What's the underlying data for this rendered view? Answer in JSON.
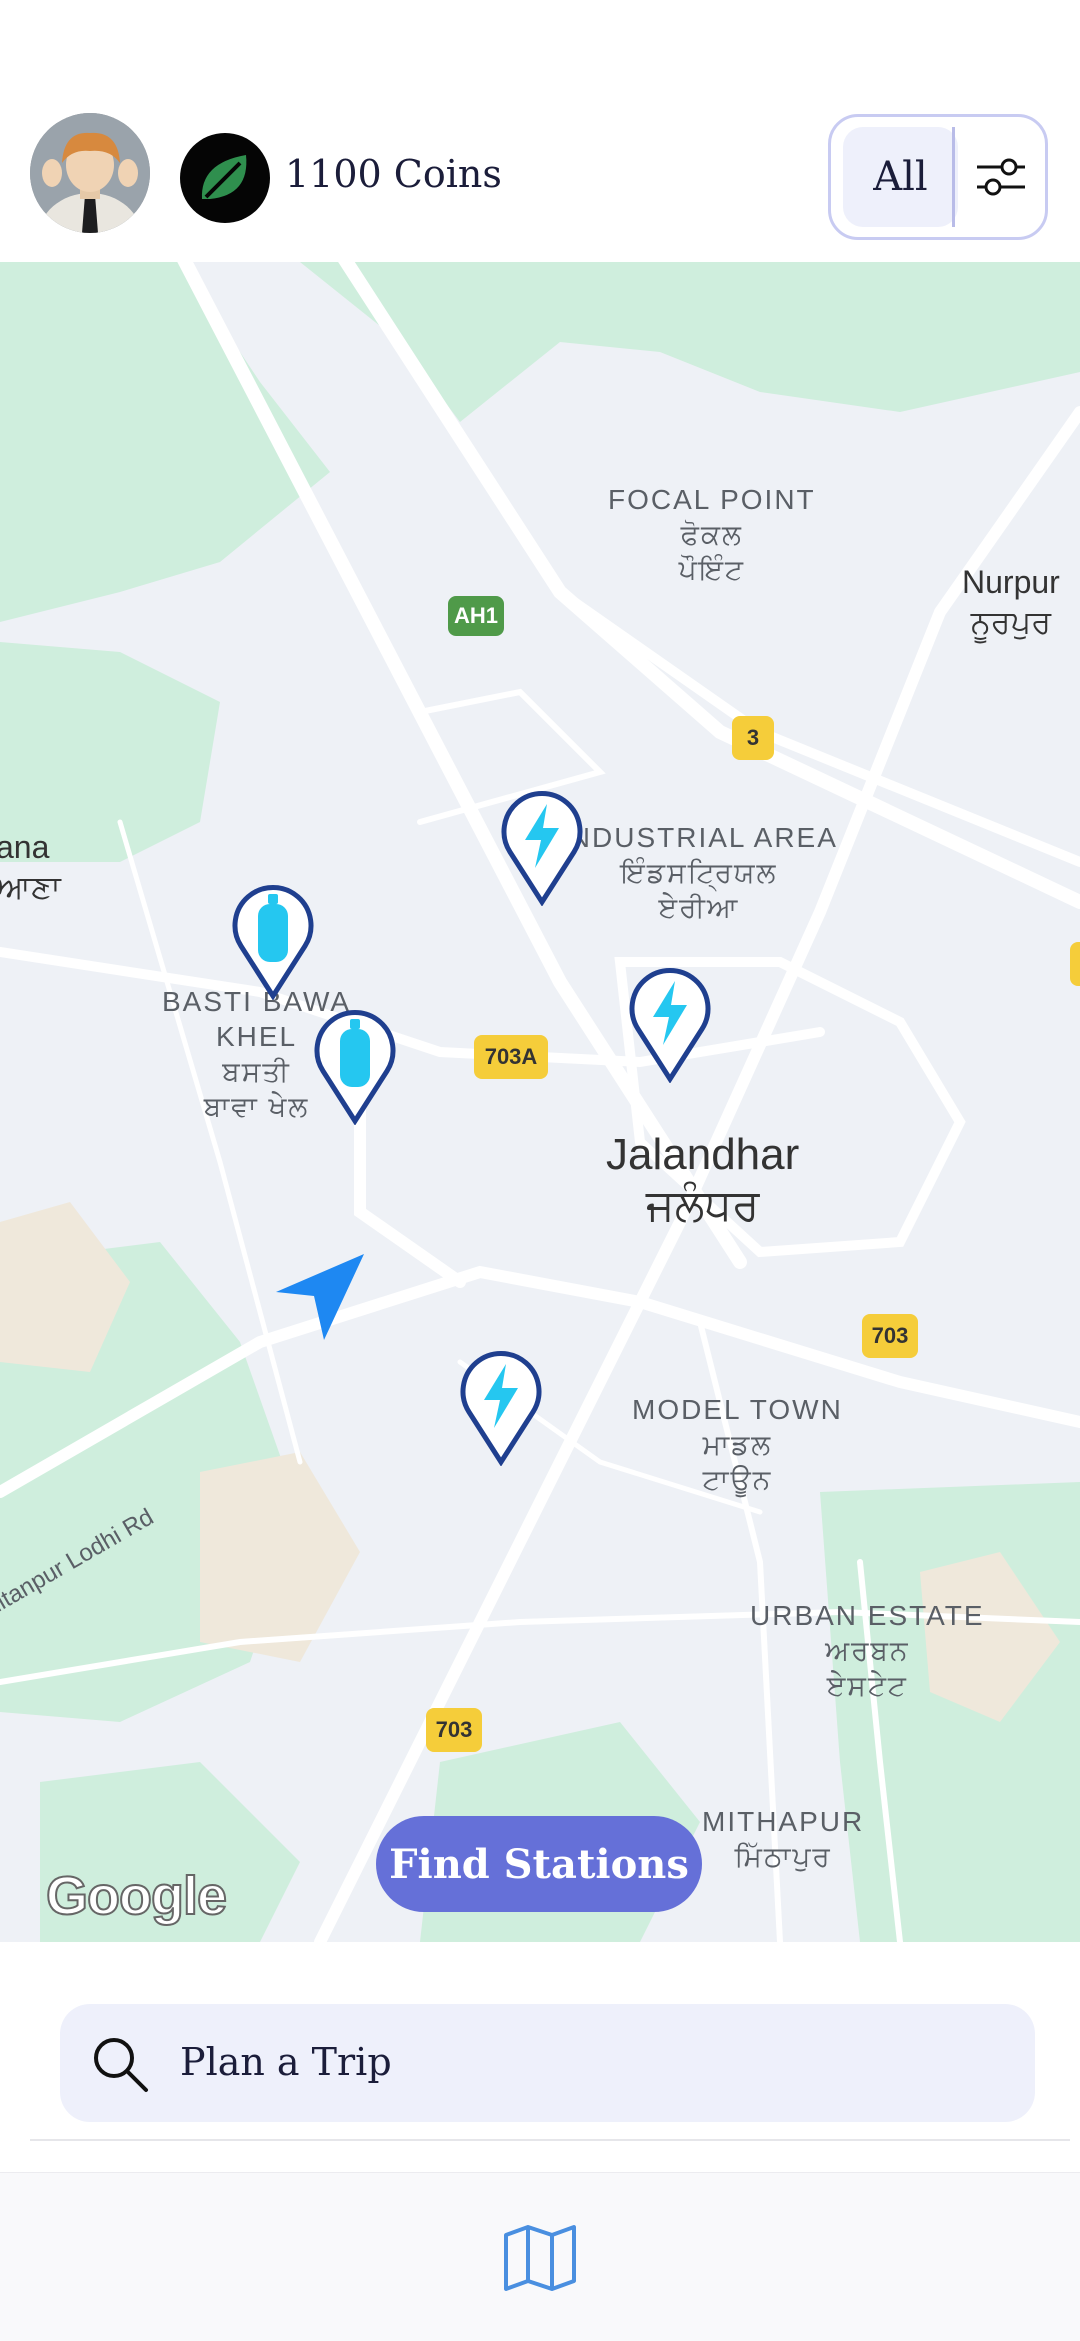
{
  "header": {
    "coins_text": "1100 Coins",
    "filter_label": "All"
  },
  "map": {
    "places": [
      {
        "id": "focal-point",
        "text": "FOCAL POINT\nਫੋਕਲ\nਪੌਇੰਟ"
      },
      {
        "id": "nurpur",
        "text": "Nurpur\nਨੂਰਪੁਰ"
      },
      {
        "id": "industrial-area",
        "text": "INDUSTRIAL AREA\nਇੰਡਸਟ੍ਰਿਯਲ\nਏਰੀਆ"
      },
      {
        "id": "ana",
        "text": "ana\nਆਣਾ"
      },
      {
        "id": "basti-bawa-khel",
        "text": "BASTI BAWA\nKHEL\nਬਸਤੀ\nਬਾਵਾ ਖੇਲ"
      },
      {
        "id": "jalandhar",
        "text": "Jalandhar\nਜਲੰਧਰ"
      },
      {
        "id": "model-town",
        "text": "MODEL TOWN\nਮਾਡਲ\nਟਾਊਨ"
      },
      {
        "id": "urban-estate",
        "text": "URBAN ESTATE\nਅਰਬਨ\nਏਸਟੇਟ"
      },
      {
        "id": "mithapur",
        "text": "MITHAPUR\nਮਿੱਠਾਪੁਰ"
      },
      {
        "id": "sultanpur-road",
        "text": "Sultanpur Lodhi Rd"
      }
    ],
    "road_shields": [
      "AH1",
      "3",
      "703A",
      "703",
      "703"
    ],
    "markers": [
      {
        "type": "ev-charging",
        "icon": "lightning-bolt-icon"
      },
      {
        "type": "ev-charging",
        "icon": "lightning-bolt-icon"
      },
      {
        "type": "ev-charging",
        "icon": "lightning-bolt-icon"
      },
      {
        "type": "gas-cylinder",
        "icon": "cylinder-icon"
      },
      {
        "type": "gas-cylinder",
        "icon": "cylinder-icon"
      }
    ],
    "attribution": "Google",
    "find_button": "Find Stations"
  },
  "search": {
    "placeholder": "Plan a Trip"
  },
  "bottom_nav": {
    "icon": "map-icon"
  },
  "colors": {
    "accent": "#6570d8",
    "marker_outline": "#1f3f8f",
    "marker_fill": "#25c7f0",
    "location_arrow": "#1e88f2",
    "map_bg": "#eef1f6",
    "green_area": "#cfeedd"
  }
}
